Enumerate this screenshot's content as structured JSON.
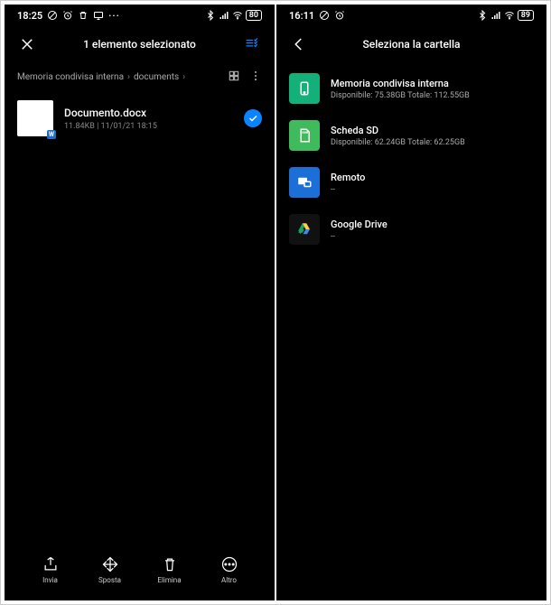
{
  "screen1": {
    "time": "18:25",
    "battery": "80",
    "title": "1 elemento selezionato",
    "breadcrumb": {
      "a": "Memoria condivisa interna",
      "b": "documents"
    },
    "file": {
      "name": "Documento.docx",
      "meta": "11.84KB | 11/01/21 18:15",
      "badge": "W"
    },
    "actions": {
      "send": "Invia",
      "move": "Sposta",
      "delete": "Elimina",
      "more": "Altro"
    }
  },
  "screen2": {
    "time": "16:11",
    "battery": "89",
    "title": "Seleziona la cartella",
    "destinations": {
      "internal": {
        "name": "Memoria condivisa interna",
        "meta": "Disponibile: 75.38GB Totale: 112.55GB"
      },
      "sd": {
        "name": "Scheda SD",
        "meta": "Disponibile: 62.24GB Totale: 62.25GB"
      },
      "remote": {
        "name": "Remoto",
        "meta": "--"
      },
      "gdrive": {
        "name": "Google Drive",
        "meta": "--"
      }
    }
  }
}
